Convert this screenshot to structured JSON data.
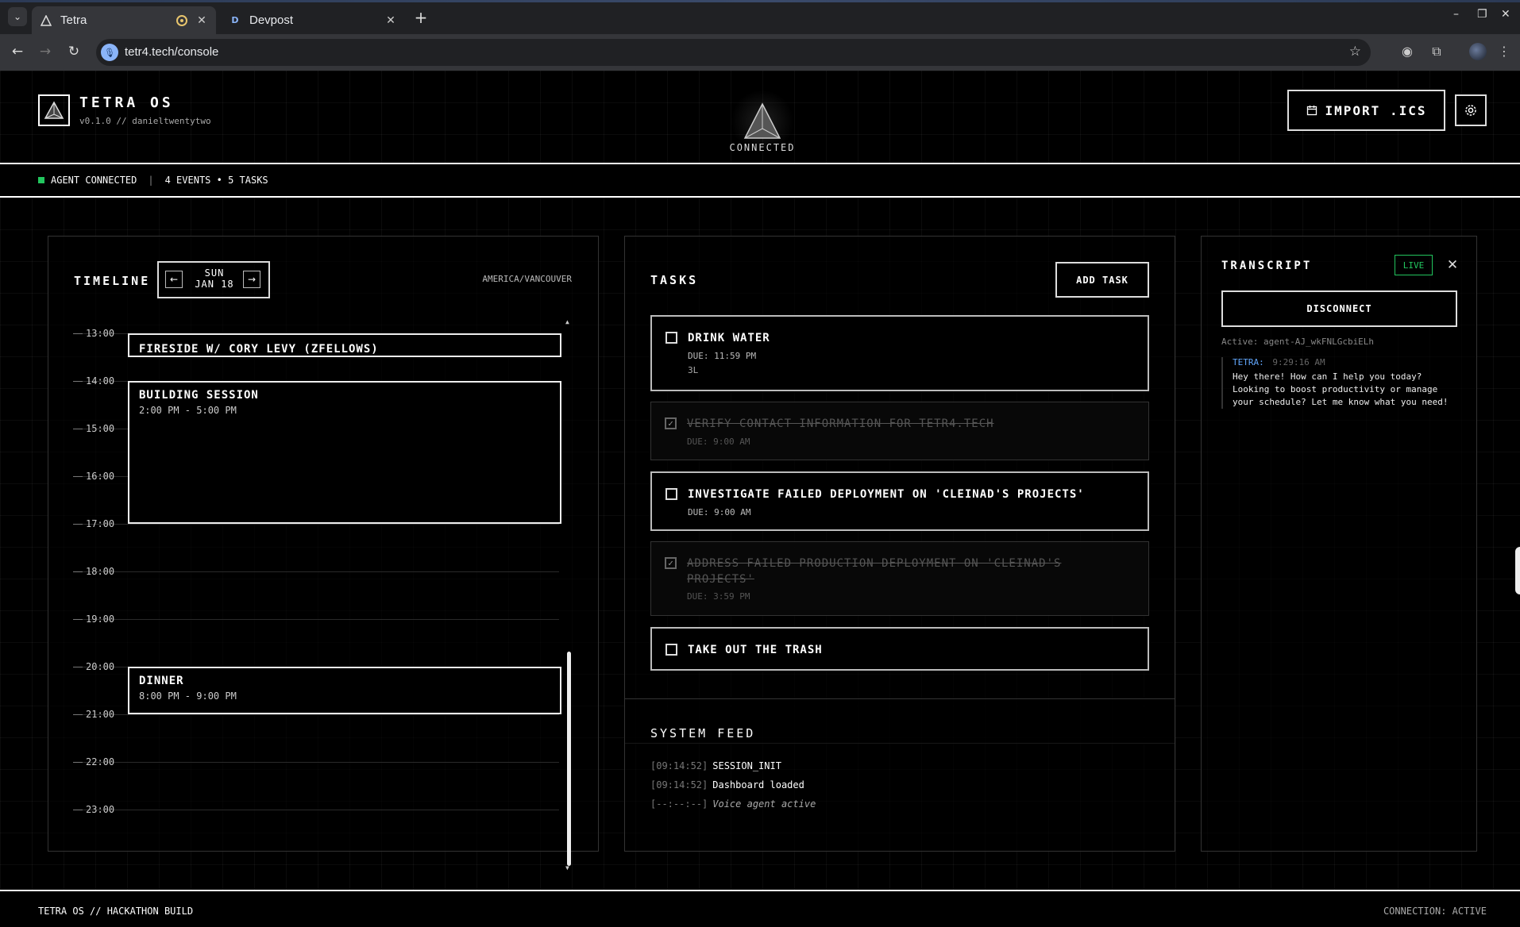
{
  "browser": {
    "tabs": [
      {
        "title": "Tetra",
        "active": true
      },
      {
        "title": "Devpost",
        "active": false
      }
    ],
    "url": "tetr4.tech/console"
  },
  "header": {
    "title": "TETRA OS",
    "subtitle": "v0.1.0 // danieltwentytwo",
    "connection_label": "CONNECTED",
    "import_label": "IMPORT .ICS"
  },
  "status_bar": {
    "agent": "AGENT CONNECTED",
    "summary": "4 EVENTS • 5 TASKS",
    "indicator_color": "#22c55e"
  },
  "timeline": {
    "title": "TIMELINE",
    "day": "SUN",
    "date": "JAN 18",
    "timezone": "AMERICA/VANCOUVER",
    "hours": [
      "13:00",
      "14:00",
      "15:00",
      "16:00",
      "17:00",
      "18:00",
      "19:00",
      "20:00",
      "21:00",
      "22:00",
      "23:00"
    ],
    "events": [
      {
        "title": "FIRESIDE W/ CORY LEVY (ZFELLOWS)",
        "time": ""
      },
      {
        "title": "BUILDING SESSION",
        "time": "2:00 PM - 5:00 PM"
      },
      {
        "title": "DINNER",
        "time": "8:00 PM - 9:00 PM"
      }
    ]
  },
  "tasks": {
    "title": "TASKS",
    "add_label": "ADD TASK",
    "items": [
      {
        "title": "DRINK WATER",
        "due": "DUE: 11:59 PM",
        "note": "3L",
        "done": false
      },
      {
        "title": "VERIFY CONTACT INFORMATION FOR TETR4.TECH",
        "due": "DUE: 9:00 AM",
        "done": true
      },
      {
        "title": "INVESTIGATE FAILED DEPLOYMENT ON 'CLEINAD'S PROJECTS'",
        "due": "DUE: 9:00 AM",
        "done": false
      },
      {
        "title": "ADDRESS FAILED PRODUCTION DEPLOYMENT ON 'CLEINAD'S PROJECTS'",
        "due": "DUE: 3:59 PM",
        "done": true
      },
      {
        "title": "TAKE OUT THE TRASH",
        "done": false
      }
    ]
  },
  "system_feed": {
    "title": "SYSTEM FEED",
    "lines": [
      {
        "ts": "[09:14:52]",
        "msg": "SESSION_INIT"
      },
      {
        "ts": "[09:14:52]",
        "msg": "Dashboard loaded"
      },
      {
        "ts": "[--:--:--]",
        "msg": "Voice agent active"
      }
    ]
  },
  "transcript": {
    "title": "TRANSCRIPT",
    "live_label": "LIVE",
    "disconnect_label": "DISCONNECT",
    "active_agent": "Active: agent-AJ_wkFNLGcbiELh",
    "messages": [
      {
        "speaker": "TETRA:",
        "time": "9:29:16 AM",
        "text": "Hey there! How can I help you today? Looking to boost productivity or manage your schedule? Let me know what you need!"
      }
    ]
  },
  "footer": {
    "left": "TETRA OS // HACKATHON BUILD",
    "right": "CONNECTION: ACTIVE"
  }
}
